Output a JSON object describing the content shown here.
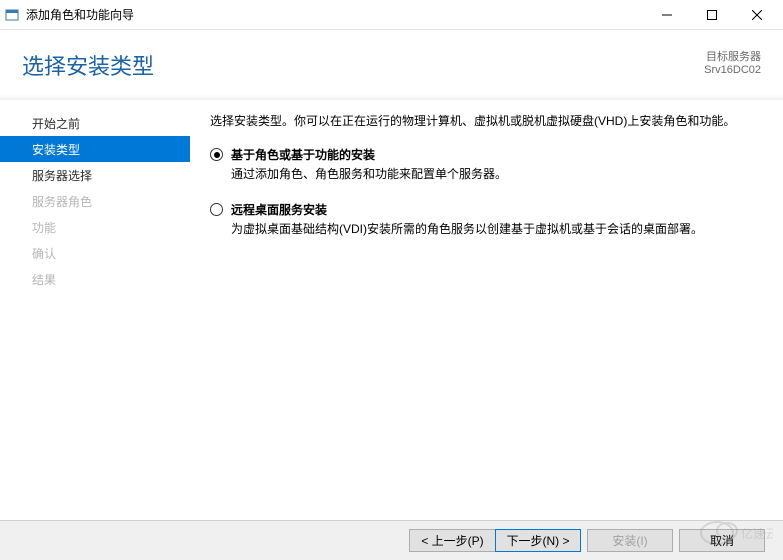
{
  "window": {
    "title": "添加角色和功能向导"
  },
  "header": {
    "heading": "选择安装类型",
    "target_label": "目标服务器",
    "target_value": "Srv16DC02"
  },
  "sidebar": {
    "items": [
      {
        "label": "开始之前",
        "state": "normal"
      },
      {
        "label": "安装类型",
        "state": "selected"
      },
      {
        "label": "服务器选择",
        "state": "normal"
      },
      {
        "label": "服务器角色",
        "state": "disabled"
      },
      {
        "label": "功能",
        "state": "disabled"
      },
      {
        "label": "确认",
        "state": "disabled"
      },
      {
        "label": "结果",
        "state": "disabled"
      }
    ]
  },
  "content": {
    "intro": "选择安装类型。你可以在正在运行的物理计算机、虚拟机或脱机虚拟硬盘(VHD)上安装角色和功能。",
    "options": [
      {
        "title": "基于角色或基于功能的安装",
        "desc": "通过添加角色、角色服务和功能来配置单个服务器。",
        "checked": true
      },
      {
        "title": "远程桌面服务安装",
        "desc": "为虚拟桌面基础结构(VDI)安装所需的角色服务以创建基于虚拟机或基于会话的桌面部署。",
        "checked": false
      }
    ]
  },
  "footer": {
    "prev": "< 上一步(P)",
    "next": "下一步(N) >",
    "install": "安装(I)",
    "cancel": "取消"
  },
  "watermark": "亿速云"
}
